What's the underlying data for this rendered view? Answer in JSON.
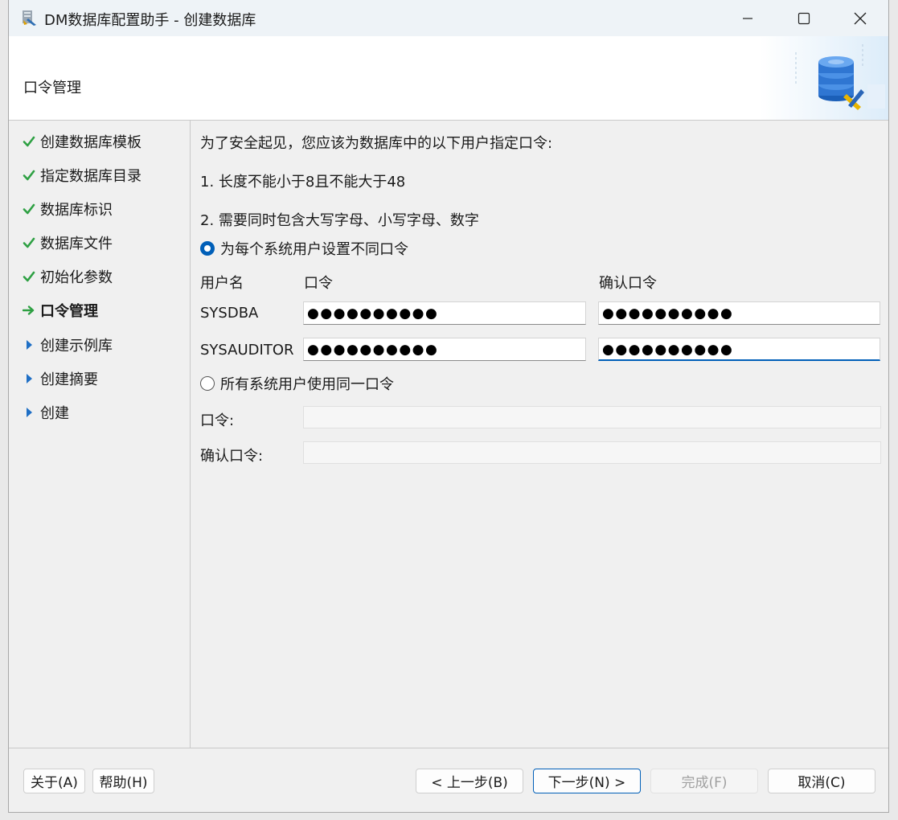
{
  "window": {
    "title": "DM数据库配置助手 - 创建数据库"
  },
  "header": {
    "title": "口令管理"
  },
  "steps": [
    {
      "label": "创建数据库模板",
      "status": "done"
    },
    {
      "label": "指定数据库目录",
      "status": "done"
    },
    {
      "label": "数据库标识",
      "status": "done"
    },
    {
      "label": "数据库文件",
      "status": "done"
    },
    {
      "label": "初始化参数",
      "status": "done"
    },
    {
      "label": "口令管理",
      "status": "current"
    },
    {
      "label": "创建示例库",
      "status": "pending"
    },
    {
      "label": "创建摘要",
      "status": "pending"
    },
    {
      "label": "创建",
      "status": "pending"
    }
  ],
  "content": {
    "intro": "为了安全起见，您应该为数据库中的以下用户指定口令:",
    "rule1": "1. 长度不能小于8且不能大于48",
    "rule2": "2. 需要同时包含大写字母、小写字母、数字",
    "option_individual": "为每个系统用户设置不同口令",
    "option_same": "所有系统用户使用同一口令",
    "col_username": "用户名",
    "col_password": "口令",
    "col_confirm": "确认口令",
    "users": [
      {
        "name": "SYSDBA",
        "password": "●●●●●●●●●●",
        "confirm": "●●●●●●●●●●"
      },
      {
        "name": "SYSAUDITOR",
        "password": "●●●●●●●●●●",
        "confirm": "●●●●●●●●●●"
      }
    ],
    "shared_password_label": "口令:",
    "shared_confirm_label": "确认口令:"
  },
  "footer": {
    "about": "关于(A)",
    "help": "帮助(H)",
    "prev": "< 上一步(B)",
    "next": "下一步(N) >",
    "finish": "完成(F)",
    "cancel": "取消(C)"
  },
  "colors": {
    "check": "#2ea043",
    "arrow": "#2ea043",
    "pending": "#1f6fc5",
    "accent": "#005fb8"
  }
}
